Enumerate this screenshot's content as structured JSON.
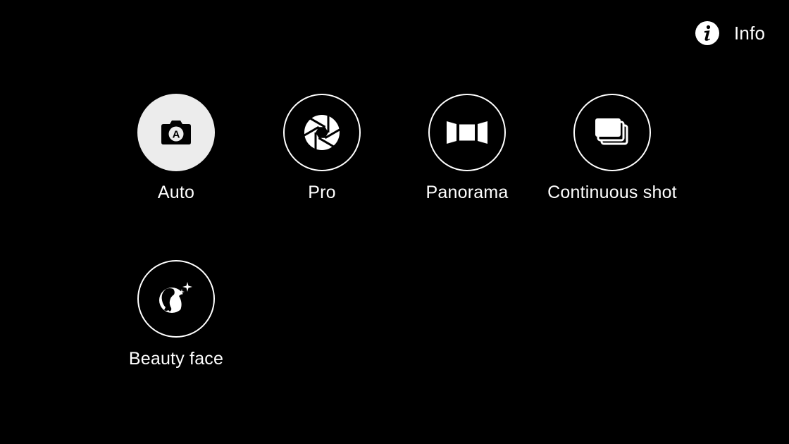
{
  "header": {
    "info_label": "Info",
    "info_icon": "info-icon"
  },
  "modes": [
    {
      "label": "Auto",
      "icon": "camera-auto-icon",
      "selected": true
    },
    {
      "label": "Pro",
      "icon": "aperture-icon",
      "selected": false
    },
    {
      "label": "Panorama",
      "icon": "panorama-icon",
      "selected": false
    },
    {
      "label": "Continuous shot",
      "icon": "stacked-photos-icon",
      "selected": false
    },
    {
      "label": "Beauty face",
      "icon": "beauty-face-icon",
      "selected": false
    }
  ],
  "colors": {
    "background": "#000000",
    "text": "#ffffff",
    "selected_fill": "#ececec"
  }
}
